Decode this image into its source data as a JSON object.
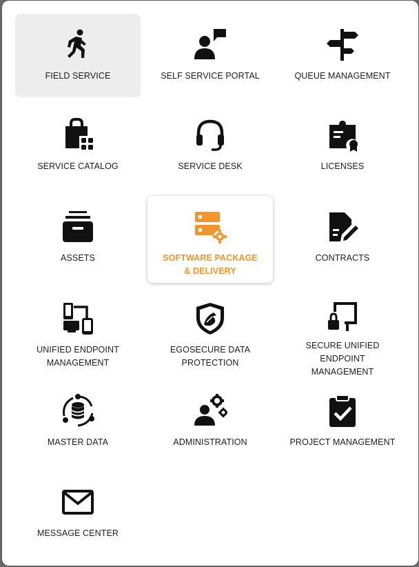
{
  "colors": {
    "accent": "#f0962d",
    "icon": "#111111",
    "selected_bg": "#ededed"
  },
  "tiles": [
    {
      "label": "FIELD SERVICE",
      "icon": "running-person-icon",
      "state": "selected"
    },
    {
      "label": "SELF SERVICE PORTAL",
      "icon": "person-flag-icon",
      "state": "normal"
    },
    {
      "label": "QUEUE MANAGEMENT",
      "icon": "signpost-icon",
      "state": "normal"
    },
    {
      "label": "SERVICE CATALOG",
      "icon": "shopping-bag-grid-icon",
      "state": "normal"
    },
    {
      "label": "SERVICE DESK",
      "icon": "headset-icon",
      "state": "normal"
    },
    {
      "label": "LICENSES",
      "icon": "license-certificate-icon",
      "state": "normal"
    },
    {
      "label": "ASSETS",
      "icon": "archive-box-icon",
      "state": "normal"
    },
    {
      "label": "SOFTWARE PACKAGE & DELIVERY",
      "icon": "server-gear-icon",
      "state": "highlight"
    },
    {
      "label": "CONTRACTS",
      "icon": "contract-pen-icon",
      "state": "normal"
    },
    {
      "label": "UNIFIED ENDPOINT MANAGEMENT",
      "icon": "devices-icon",
      "state": "normal"
    },
    {
      "label": "EGOSECURE DATA PROTECTION",
      "icon": "shield-icon",
      "state": "normal"
    },
    {
      "label": "SECURE UNIFIED ENDPOINT MANAGEMENT",
      "icon": "lock-devices-icon",
      "state": "normal"
    },
    {
      "label": "MASTER DATA",
      "icon": "database-cycle-icon",
      "state": "normal"
    },
    {
      "label": "ADMINISTRATION",
      "icon": "admin-gears-icon",
      "state": "normal"
    },
    {
      "label": "PROJECT MANAGEMENT",
      "icon": "clipboard-check-icon",
      "state": "normal"
    },
    {
      "label": "MESSAGE CENTER",
      "icon": "envelope-icon",
      "state": "normal"
    }
  ]
}
